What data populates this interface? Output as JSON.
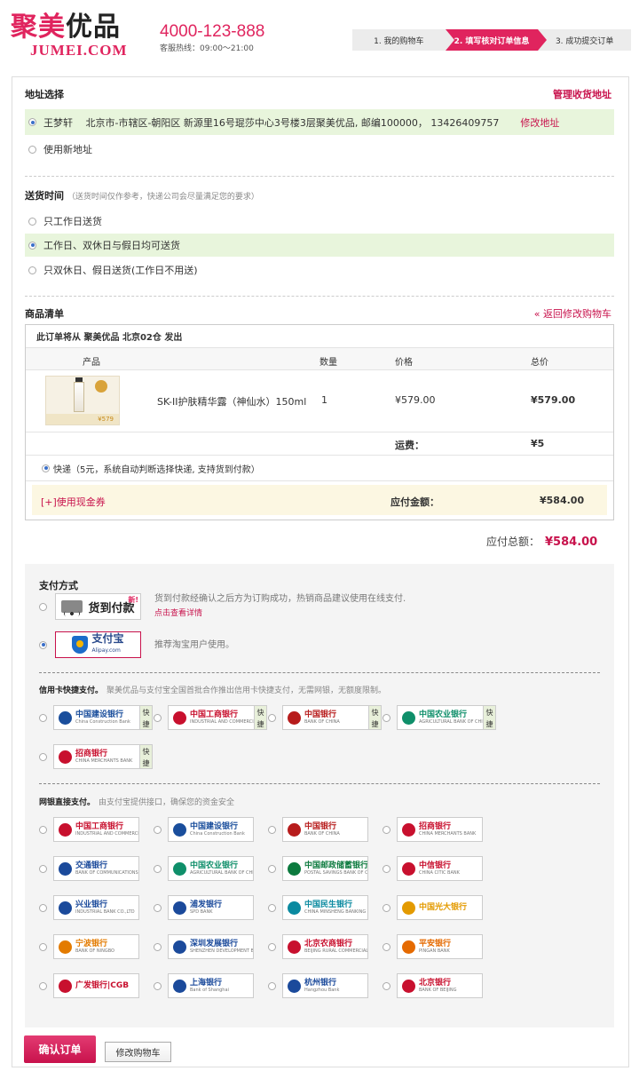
{
  "header": {
    "logo_cn_a": "聚美",
    "logo_cn_b": "优品",
    "logo_en": "JUMEI.COM",
    "hotline": "4000-123-888",
    "hotline_hours": "客服热线：09:00～21:00",
    "steps": [
      "1. 我的购物车",
      "2. 填写核对订单信息",
      "3. 成功提交订单"
    ],
    "active_step": 1
  },
  "address": {
    "title": "地址选择",
    "manage_link": "管理收货地址",
    "selected": "王梦轩　 北京市-市辖区-朝阳区 新源里16号琨莎中心3号楼3层聚美优品, 邮编100000， 13426409757",
    "edit_link": "修改地址",
    "new_address": "使用新地址"
  },
  "delivery": {
    "title": "送货时间",
    "note": "（送货时间仅作参考，快递公司会尽量满足您的要求）",
    "options": [
      "只工作日送货",
      "工作日、双休日与假日均可送货",
      "只双休日、假日送货(工作日不用送)"
    ],
    "selected": 1
  },
  "goods": {
    "title": "商品清单",
    "back_link": "« 返回修改购物车",
    "ship_from": "此订单将从 聚美优品 北京02仓 发出",
    "columns": [
      "产品",
      "数量",
      "价格",
      "总价"
    ],
    "item": {
      "name": "SK-II护肤精华露（神仙水）150ml",
      "qty": "1",
      "price": "¥579.00",
      "total": "¥579.00",
      "img_price": "¥579"
    },
    "shipping_label": "运费：",
    "shipping_fee": "¥5",
    "shipping_method": "快递（5元，系统自动判断选择快递, 支持货到付款）",
    "coupon_link": "[+]使用现金券",
    "payable_label": "应付金额：",
    "payable": "¥584.00",
    "grand_label": "应付总额：",
    "grand_total": "¥584.00"
  },
  "payment": {
    "title": "支付方式",
    "cod": {
      "label": "货到付款",
      "badge": "新!",
      "desc": "货到付款经确认之后方为订购成功，热销商品建议使用在线支付.",
      "link": "点击查看详情"
    },
    "alipay": {
      "label": "支付宝",
      "sub": "Alipay.com",
      "desc": "推荐淘宝用户使用。"
    },
    "credit_title": "信用卡快捷支付。",
    "credit_note": "聚美优品与支付宝全国首批合作推出信用卡快捷支付，无需网银，无额度限制。",
    "fast_label": "快捷",
    "credit_banks": [
      {
        "name": "中国建设银行",
        "en": "China Construction Bank",
        "color": "#1a4e9c"
      },
      {
        "name": "中国工商银行",
        "en": "INDUSTRIAL AND COMMERCIAL BANK OF CHINA",
        "color": "#c8102e"
      },
      {
        "name": "中国银行",
        "en": "BANK OF CHINA",
        "color": "#b71c1c"
      },
      {
        "name": "中国农业银行",
        "en": "AGRICULTURAL BANK OF CHINA",
        "color": "#0f8f6a"
      },
      {
        "name": "招商银行",
        "en": "CHINA MERCHANTS BANK",
        "color": "#c8102e"
      }
    ],
    "net_title": "网银直接支付。",
    "net_note": "由支付宝提供接口，确保您的资金安全",
    "net_banks": [
      {
        "name": "中国工商银行",
        "en": "INDUSTRIAL AND COMMERCIAL BANK OF CHINA",
        "color": "#c8102e"
      },
      {
        "name": "中国建设银行",
        "en": "China Construction Bank",
        "color": "#1a4e9c"
      },
      {
        "name": "中国银行",
        "en": "BANK OF CHINA",
        "color": "#b71c1c"
      },
      {
        "name": "招商银行",
        "en": "CHINA MERCHANTS BANK",
        "color": "#c8102e"
      },
      {
        "name": "交通银行",
        "en": "BANK OF COMMUNICATIONS",
        "color": "#1b4a9b"
      },
      {
        "name": "中国农业银行",
        "en": "AGRICULTURAL BANK OF CHINA",
        "color": "#0f8f6a"
      },
      {
        "name": "中国邮政储蓄银行",
        "en": "POSTAL SAVINGS BANK OF CHINA",
        "color": "#0c7a3e"
      },
      {
        "name": "中信银行",
        "en": "CHINA CITIC BANK",
        "color": "#c8102e"
      },
      {
        "name": "兴业银行",
        "en": "INDUSTRIAL BANK CO.,LTD",
        "color": "#1b4a9b"
      },
      {
        "name": "浦发银行",
        "en": "SPD BANK",
        "color": "#1b4a9b"
      },
      {
        "name": "中国民生银行",
        "en": "CHINA MINSHENG BANKING CORP.,LTD",
        "color": "#0b8aa0"
      },
      {
        "name": "中国光大银行",
        "en": "",
        "color": "#e39a00"
      },
      {
        "name": "宁波银行",
        "en": "BANK OF NINGBO",
        "color": "#e37b00"
      },
      {
        "name": "深圳发展银行",
        "en": "SHENZHEN DEVELOPMENT BANK",
        "color": "#1b4a9b"
      },
      {
        "name": "北京农商银行",
        "en": "BEIJING RURAL COMMERCIAL BANK",
        "color": "#c8102e"
      },
      {
        "name": "平安银行",
        "en": "PINGAN BANK",
        "color": "#e56a00"
      },
      {
        "name": "广发银行|CGB",
        "en": "",
        "color": "#c8102e"
      },
      {
        "name": "上海银行",
        "en": "Bank of Shanghai",
        "color": "#1b4a9b"
      },
      {
        "name": "杭州银行",
        "en": "Hangzhou Bank",
        "color": "#1b4a9b"
      },
      {
        "name": "北京银行",
        "en": "BANK OF BEIJING",
        "color": "#c8102e"
      }
    ]
  },
  "actions": {
    "confirm": "确认订单",
    "back": "修改购物车"
  }
}
